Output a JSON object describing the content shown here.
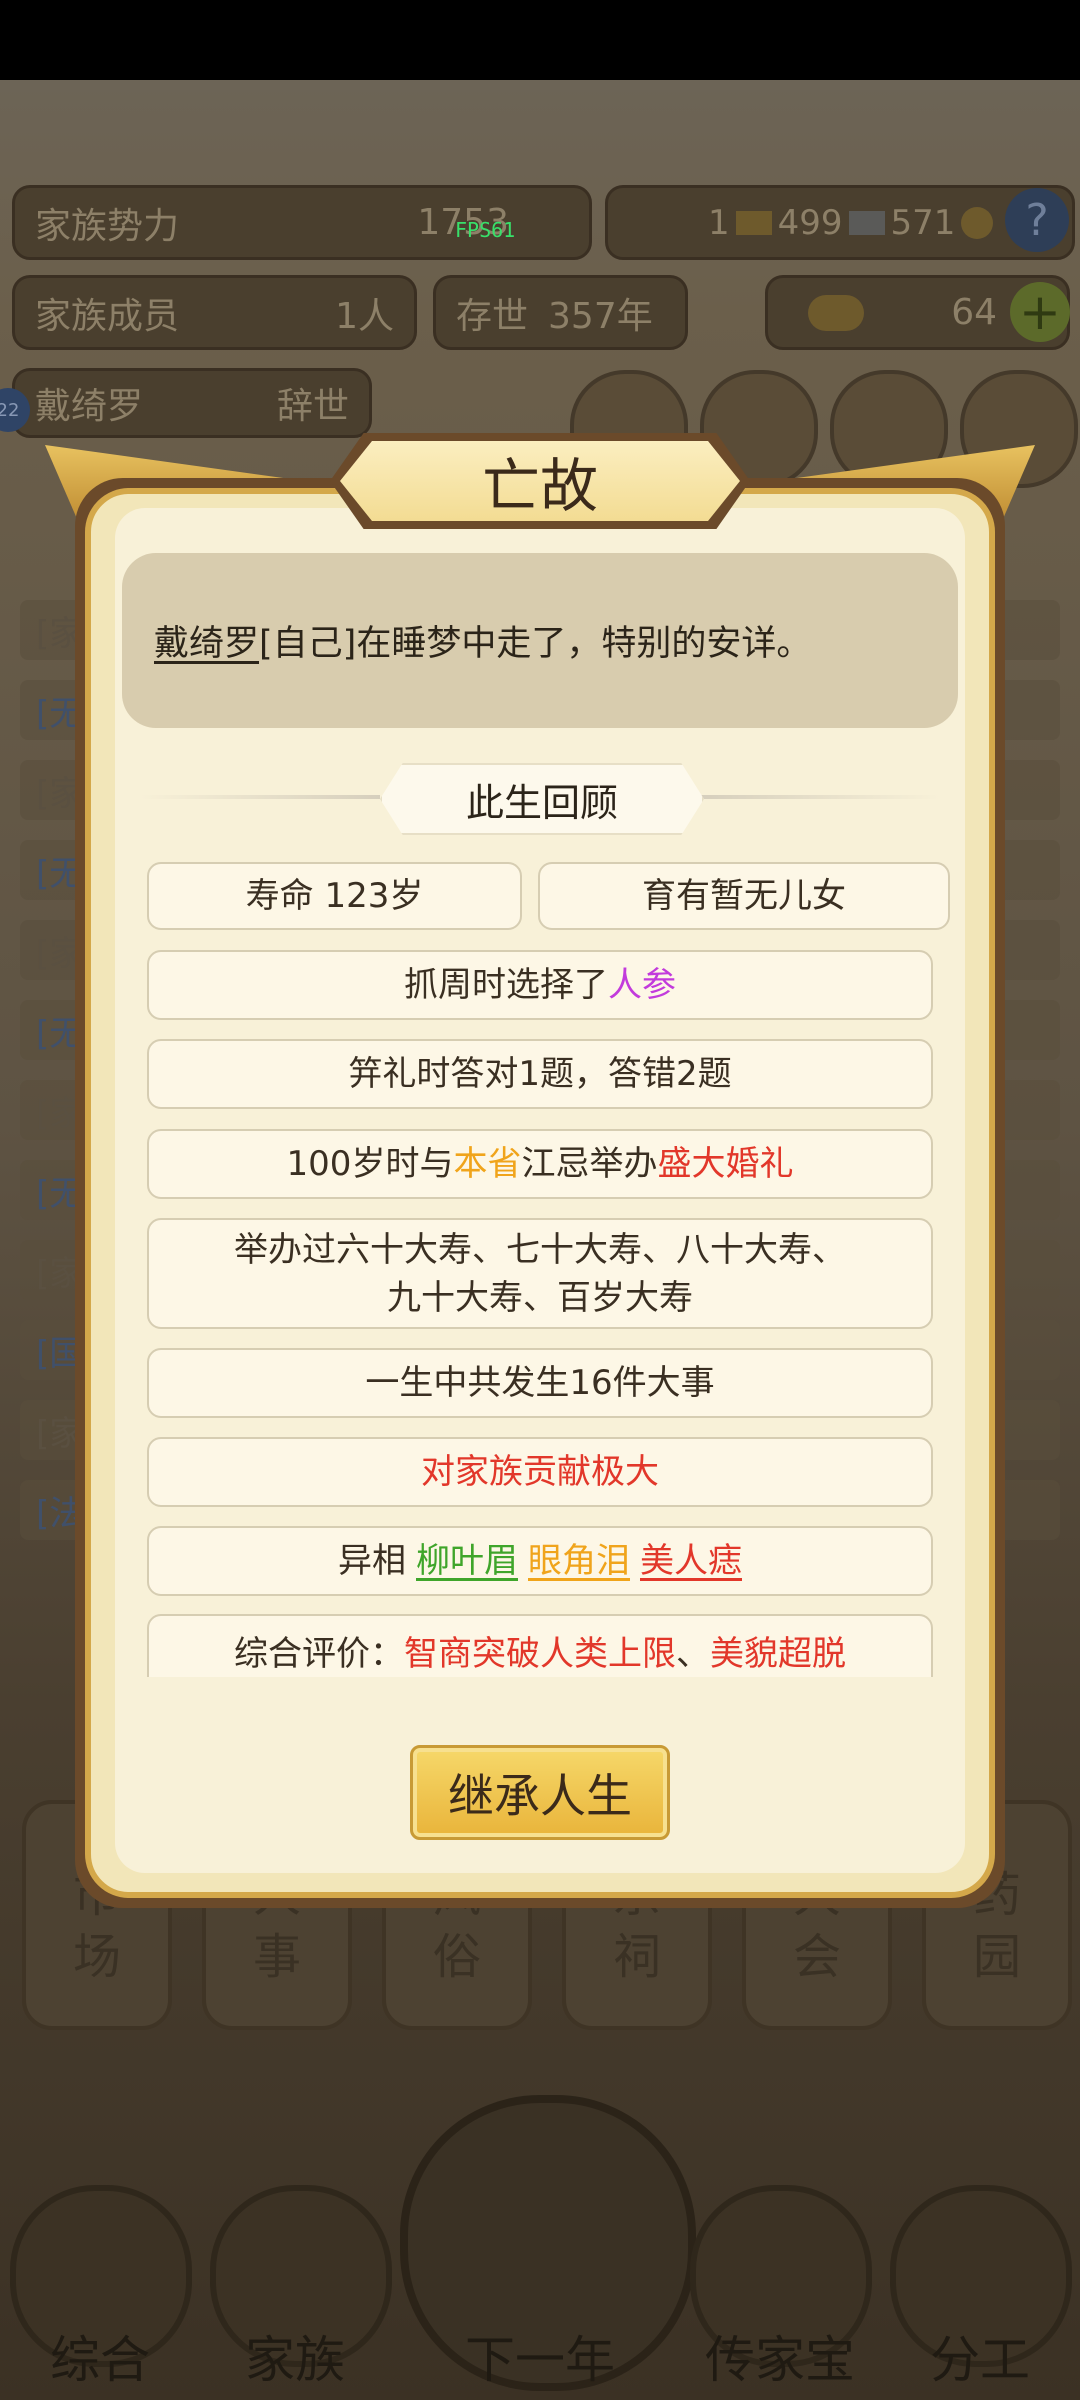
{
  "hud": {
    "influence_label": "家族势力",
    "influence_value": "1753",
    "fps": "FPS61",
    "gold_count": "1",
    "silver_count": "499",
    "paper_count": "571",
    "members_label": "家族成员",
    "members_value": "1人",
    "survive_label": "存世",
    "survive_value": "357年",
    "ingot_count": "64",
    "char_name": "戴绮罗",
    "char_status": "辞世",
    "badge_num": "22"
  },
  "nav_cards": [
    "市\n场",
    "人\n事",
    "风\n俗",
    "宗\n祠",
    "大\n会",
    "药\n园"
  ],
  "bottom_nav": [
    "综合",
    "家族",
    "下一年",
    "传家宝",
    "分工"
  ],
  "modal": {
    "title": "亡故",
    "message_name": "戴绮罗",
    "message_rest": "[自己]在睡梦中走了，特别的安详。",
    "section_title": "此生回顾",
    "lifespan": "寿命 123岁",
    "children": "育有暂无儿女",
    "zhuazhou_prefix": "抓周时选择了",
    "zhuazhou_item": "人参",
    "jili": "笄礼时答对1题，答错2题",
    "wedding_prefix": "100岁时与",
    "wedding_place": "本省",
    "wedding_mid": "江忌举办",
    "wedding_type": "盛大婚礼",
    "birthday_line1": "举办过六十大寿、七十大寿、八十大寿、",
    "birthday_line2": "九十大寿、百岁大寿",
    "events": "一生中共发生16件大事",
    "contribution": "对家族贡献极大",
    "traits_label": "异相",
    "trait1": "柳叶眉",
    "trait2": "眼角泪",
    "trait3": "美人痣",
    "eval_label": "综合评价：",
    "eval_part1": "智商突破人类上限",
    "eval_sep": "、",
    "eval_part2": "美貌超脱",
    "inherit_button": "继承人生"
  },
  "colors": {
    "modal_bg": "#f8f1d8",
    "gold_border": "#d4a84a",
    "highlight_purple": "#c23bdc",
    "highlight_orange": "#f0a41b",
    "highlight_red": "#e2372a",
    "highlight_green": "#3fa52a"
  }
}
